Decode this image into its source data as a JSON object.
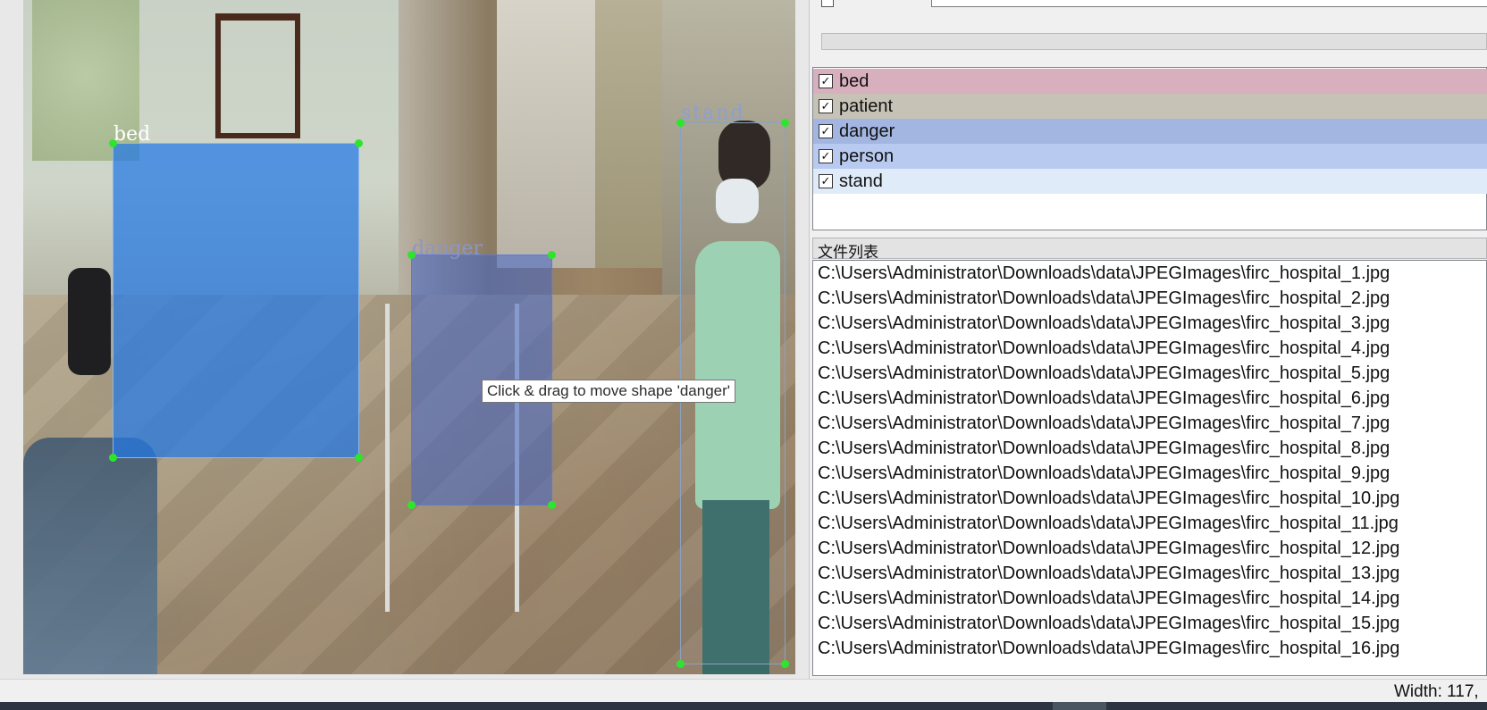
{
  "canvas": {
    "shapes": [
      {
        "label": "bed"
      },
      {
        "label": "danger"
      },
      {
        "label": "stand"
      }
    ],
    "tooltip": "Click & drag to move shape 'danger'"
  },
  "label_panel": {
    "items": [
      {
        "label": "bed",
        "checked": true,
        "color": "#d8b0bd"
      },
      {
        "label": "patient",
        "checked": true,
        "color": "#c6c2b6"
      },
      {
        "label": "danger",
        "checked": true,
        "color": "#a2b6e1"
      },
      {
        "label": "person",
        "checked": true,
        "color": "#b8caf0"
      },
      {
        "label": "stand",
        "checked": true,
        "color": "#e0ebfa"
      }
    ]
  },
  "file_panel": {
    "title": "文件列表",
    "files": [
      "C:\\Users\\Administrator\\Downloads\\data\\JPEGImages\\firc_hospital_1.jpg",
      "C:\\Users\\Administrator\\Downloads\\data\\JPEGImages\\firc_hospital_2.jpg",
      "C:\\Users\\Administrator\\Downloads\\data\\JPEGImages\\firc_hospital_3.jpg",
      "C:\\Users\\Administrator\\Downloads\\data\\JPEGImages\\firc_hospital_4.jpg",
      "C:\\Users\\Administrator\\Downloads\\data\\JPEGImages\\firc_hospital_5.jpg",
      "C:\\Users\\Administrator\\Downloads\\data\\JPEGImages\\firc_hospital_6.jpg",
      "C:\\Users\\Administrator\\Downloads\\data\\JPEGImages\\firc_hospital_7.jpg",
      "C:\\Users\\Administrator\\Downloads\\data\\JPEGImages\\firc_hospital_8.jpg",
      "C:\\Users\\Administrator\\Downloads\\data\\JPEGImages\\firc_hospital_9.jpg",
      "C:\\Users\\Administrator\\Downloads\\data\\JPEGImages\\firc_hospital_10.jpg",
      "C:\\Users\\Administrator\\Downloads\\data\\JPEGImages\\firc_hospital_11.jpg",
      "C:\\Users\\Administrator\\Downloads\\data\\JPEGImages\\firc_hospital_12.jpg",
      "C:\\Users\\Administrator\\Downloads\\data\\JPEGImages\\firc_hospital_13.jpg",
      "C:\\Users\\Administrator\\Downloads\\data\\JPEGImages\\firc_hospital_14.jpg",
      "C:\\Users\\Administrator\\Downloads\\data\\JPEGImages\\firc_hospital_15.jpg",
      "C:\\Users\\Administrator\\Downloads\\data\\JPEGImages\\firc_hospital_16.jpg"
    ]
  },
  "status_bar": {
    "text": "Width: 117,"
  },
  "icons": {
    "checkbox": "check-mark"
  }
}
